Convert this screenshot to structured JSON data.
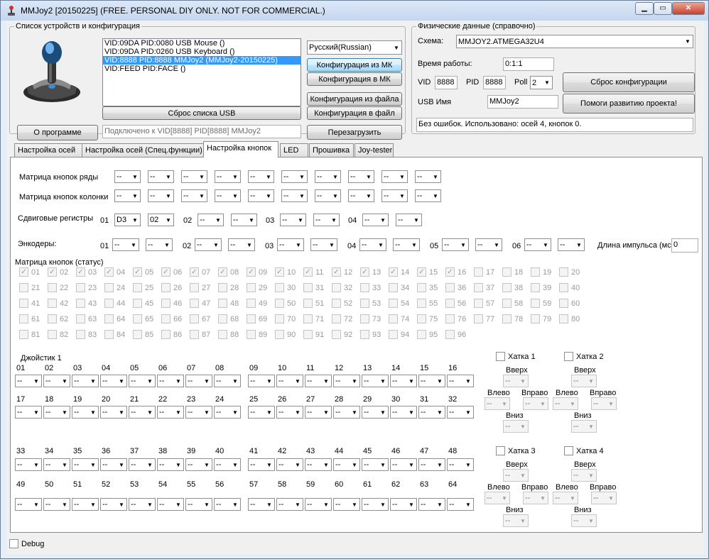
{
  "window": {
    "title": "MMJoy2 [20150225] (FREE. PERSONAL DIY ONLY. NOT FOR COMMERCIAL.)"
  },
  "devices": {
    "group_title": "Список устройств и конфигурация",
    "list": [
      "VID:09DA PID:0080 USB Mouse ()",
      "VID:09DA PID:0260 USB Keyboard ()",
      "VID:8888 PID:8888 MMJoy2 (MMJoy2-20150225)",
      "VID:FEED PID:FACE  ()"
    ],
    "selected_index": 2,
    "language": "Русский(Russian)",
    "btn_config_from_mk": "Конфигурация из МК",
    "btn_config_to_mk": "Конфигурация в МК",
    "btn_config_from_file": "Конфигурация из файла",
    "btn_config_to_file": "Конфигурация в файл",
    "btn_reset_usb": "Сброс списка USB",
    "btn_about": "О программе",
    "btn_reboot": "Перезагрузить",
    "connected": "Подключено к VID[8888] PID[8888] MMJoy2"
  },
  "physical": {
    "group_title": "Физические данные (справочно)",
    "scheme_label": "Схема:",
    "scheme_value": "MMJOY2.ATMEGA32U4",
    "uptime_label": "Время работы:",
    "uptime_value": "0:1:1",
    "vid_label": "VID",
    "vid_value": "8888",
    "pid_label": "PID",
    "pid_value": "8888",
    "poll_label": "Poll",
    "poll_value": "2",
    "usb_name_label": "USB Имя",
    "usb_name_value": "MMJoy2",
    "btn_reset_config": "Сброс конфигурации",
    "btn_help": "Помоги развитию проекта!",
    "status": "Без ошибок. Использовано: осей  4, кнопок  0."
  },
  "tabs": [
    "Настройка осей",
    "Настройка осей (Спец.функции)",
    "Настройка кнопок",
    "LED",
    "Прошивка",
    "Joy-tester"
  ],
  "active_tab": 2,
  "buttons_tab": {
    "matrix_rows_label": "Матрица кнопок ряды",
    "matrix_cols_label": "Матрица кнопок колонки",
    "shift_label": "Сдвиговые регистры",
    "encoders_label": "Энкодеры:",
    "pulse_label": "Длина импульса (мс",
    "pulse_value": "0",
    "dash": "--",
    "shift_nums": [
      "01",
      "02",
      "03",
      "04"
    ],
    "shift_values": [
      "D3",
      "02"
    ],
    "enc_nums": [
      "01",
      "02",
      "03",
      "04",
      "05",
      "06"
    ],
    "matrix_status_label": "Матрица кнопок (статус)",
    "checked_upto": 16,
    "joystick_label": "Джойстик 1",
    "hat_labels": [
      "Хатка 1",
      "Хатка 2",
      "Хатка 3",
      "Хатка 4"
    ],
    "hat_up": "Вверх",
    "hat_left": "Влево",
    "hat_right": "Вправо",
    "hat_down": "Вниз"
  },
  "debug_label": "Debug"
}
